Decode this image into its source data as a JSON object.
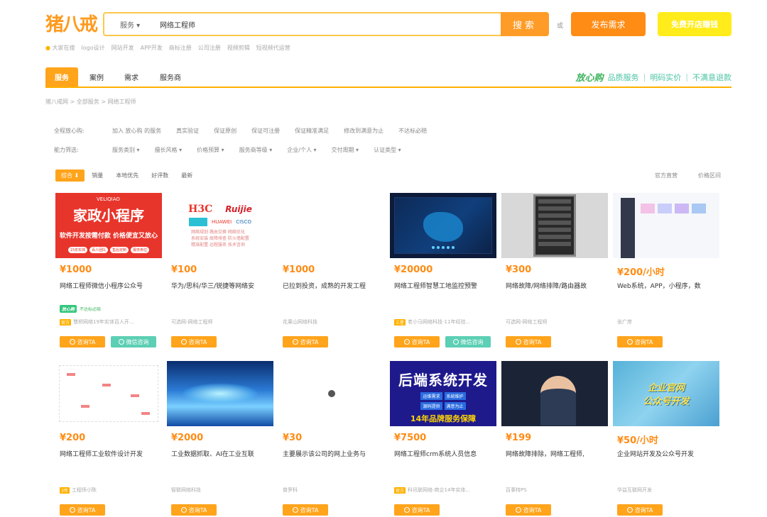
{
  "header": {
    "logo": "猪八戒",
    "search_type": "服务 ▾",
    "search_value": "网络工程师",
    "search_btn": "搜索",
    "or_text": "或",
    "publish_btn": "发布需求",
    "open_btn": "免费开店赚钱",
    "hot_keywords": [
      "大家在搜",
      "logo设计",
      "网站开发",
      "APP开发",
      "商标注册",
      "公司注册",
      "视频剪辑",
      "短视频代运营"
    ]
  },
  "tabs": [
    "服务",
    "案例",
    "需求",
    "服务商"
  ],
  "assurance": {
    "brand": "放心购",
    "items": [
      "品质服务",
      "明码实价",
      "不满意退款"
    ]
  },
  "breadcrumb": "猪八戒网 > 全部服务 > 网络工程师",
  "filters": {
    "row1_label": "全程放心购:",
    "row1_options": [
      "加入 放心购 的服务",
      "真实验证",
      "保证原创",
      "保证可注册",
      "保证精准满足",
      "修改到满意为止",
      "不达标必赔"
    ],
    "row2_label": "能力筛选:",
    "row2_options": [
      "服务类别 ▾",
      "擅长风格 ▾",
      "价格预算 ▾",
      "服务商等级 ▾",
      "企业/个人 ▾",
      "交付周期 ▾",
      "认证类型 ▾"
    ]
  },
  "sort": {
    "items": [
      "综合 ⬇",
      "销量",
      "本地优先",
      "好评数",
      "最新"
    ],
    "right": [
      "官方直营",
      "价格区间"
    ]
  },
  "cards": [
    {
      "price": "¥1000",
      "title": "网络工程师微信小程序公众号",
      "shop": "慧桥网络19年实体百人开...",
      "tag": "官方",
      "consult": "咨询TA",
      "wechat": "微信咨询",
      "badge": "放心购",
      "badge_text": "不达标必赔",
      "thumb": {
        "logo": "VELIQIAO",
        "big": "家政小程序",
        "sub": "软件开发按需付款  价格便宜又放心",
        "pills": [
          "15年实体",
          "百人团队",
          "售后定制",
          "服务到位"
        ]
      }
    },
    {
      "price": "¥100",
      "title": "华为/思科/华三/锐捷等网络安",
      "shop": "可选网-网络工程师",
      "consult": "咨询TA",
      "thumb": {
        "h3c": "H3C",
        "ruijie": "Ruijie",
        "huawei": "HUAWEI",
        "cisco": "CISCO",
        "lines": [
          "网络规划 路由交换 网络优化",
          "系统安装 故障排查 防火墙配置",
          "精准配置 远程服务 技术咨询"
        ]
      }
    },
    {
      "price": "¥1000",
      "title": "已拉到投资，成熟的开发工程",
      "shop": "花果山网络科技",
      "consult": "咨询TA"
    },
    {
      "price": "¥20000",
      "title": "网络工程师智慧工地监控预警",
      "shop": "老小马网络科技-11年经验...",
      "tag": "三星",
      "consult": "咨询TA",
      "wechat": "微信咨询"
    },
    {
      "price": "¥300",
      "title": "网络故障/网络排障/路由器故",
      "shop": "可选网-网络工程师",
      "consult": "咨询TA"
    },
    {
      "price": "¥200/小时",
      "title": "Web系统，APP，小程序，数",
      "shop": "张广岸",
      "consult": "咨询TA"
    },
    {
      "price": "¥200",
      "title": "网络工程师工业软件设计开发",
      "shop": "工程师小陈",
      "tag": "3年",
      "consult": "咨询TA"
    },
    {
      "price": "¥2000",
      "title": "工业数据抓取、AI在工业互联",
      "shop": "智联网络科技",
      "consult": "咨询TA"
    },
    {
      "price": "¥30",
      "title": "主要展示该公司的网上业务与",
      "shop": "普罗科",
      "consult": "咨询TA"
    },
    {
      "price": "¥7500",
      "title": "网络工程师crm系统人员信息",
      "shop": "科讯联网络-商企14年实体...",
      "tag": "官方",
      "consult": "咨询TA",
      "thumb": {
        "big": "后端系统开发",
        "chips": [
          "运维需求",
          "系统维护",
          "源码提供",
          "满意为止"
        ],
        "yellow": "14年品牌服务保障"
      }
    },
    {
      "price": "¥199",
      "title": "网络故障排除，网络工程师,",
      "shop": "百事特PS",
      "consult": "咨询TA"
    },
    {
      "price": "¥50/小时",
      "title": "企业网站开发及公众号开发",
      "shop": "华益互联网开发",
      "consult": "咨询TA",
      "thumb": {
        "line1": "企业官网",
        "line2": "公众号开发"
      }
    }
  ],
  "colors": {
    "accent": "#ffa41b",
    "price": "#ff8c14",
    "wechat": "#5ccfb4",
    "assurance": "#3fb35e"
  }
}
